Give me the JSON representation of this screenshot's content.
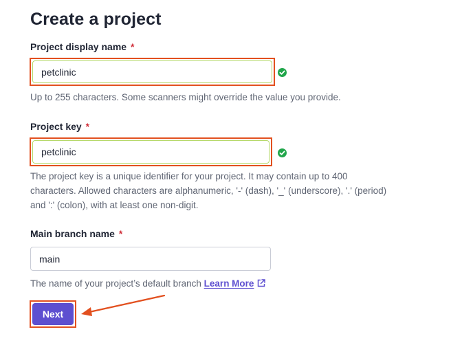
{
  "page": {
    "title": "Create a project"
  },
  "form": {
    "display_name": {
      "label": "Project display name",
      "required_mark": "*",
      "value": "petclinic",
      "help": "Up to 255 characters. Some scanners might override the value you provide.",
      "status_icon": "check-circle-icon"
    },
    "project_key": {
      "label": "Project key",
      "required_mark": "*",
      "value": "petclinic",
      "help_line1": "The project key is a unique identifier for your project. It may contain up to 400",
      "help_line2": "characters. Allowed characters are alphanumeric, '-' (dash), '_' (underscore), '.' (period)",
      "help_line3": "and ':' (colon), with at least one non-digit.",
      "status_icon": "check-circle-icon"
    },
    "main_branch": {
      "label": "Main branch name",
      "required_mark": "*",
      "value": "main",
      "help": "The name of your project’s default branch",
      "link_label": "Learn More",
      "link_icon": "external-link-icon"
    },
    "next_label": "Next"
  },
  "colors": {
    "accent": "#5d4fd0",
    "highlight": "#e2501f",
    "valid": "#21a64b",
    "required": "#d02f3a"
  }
}
